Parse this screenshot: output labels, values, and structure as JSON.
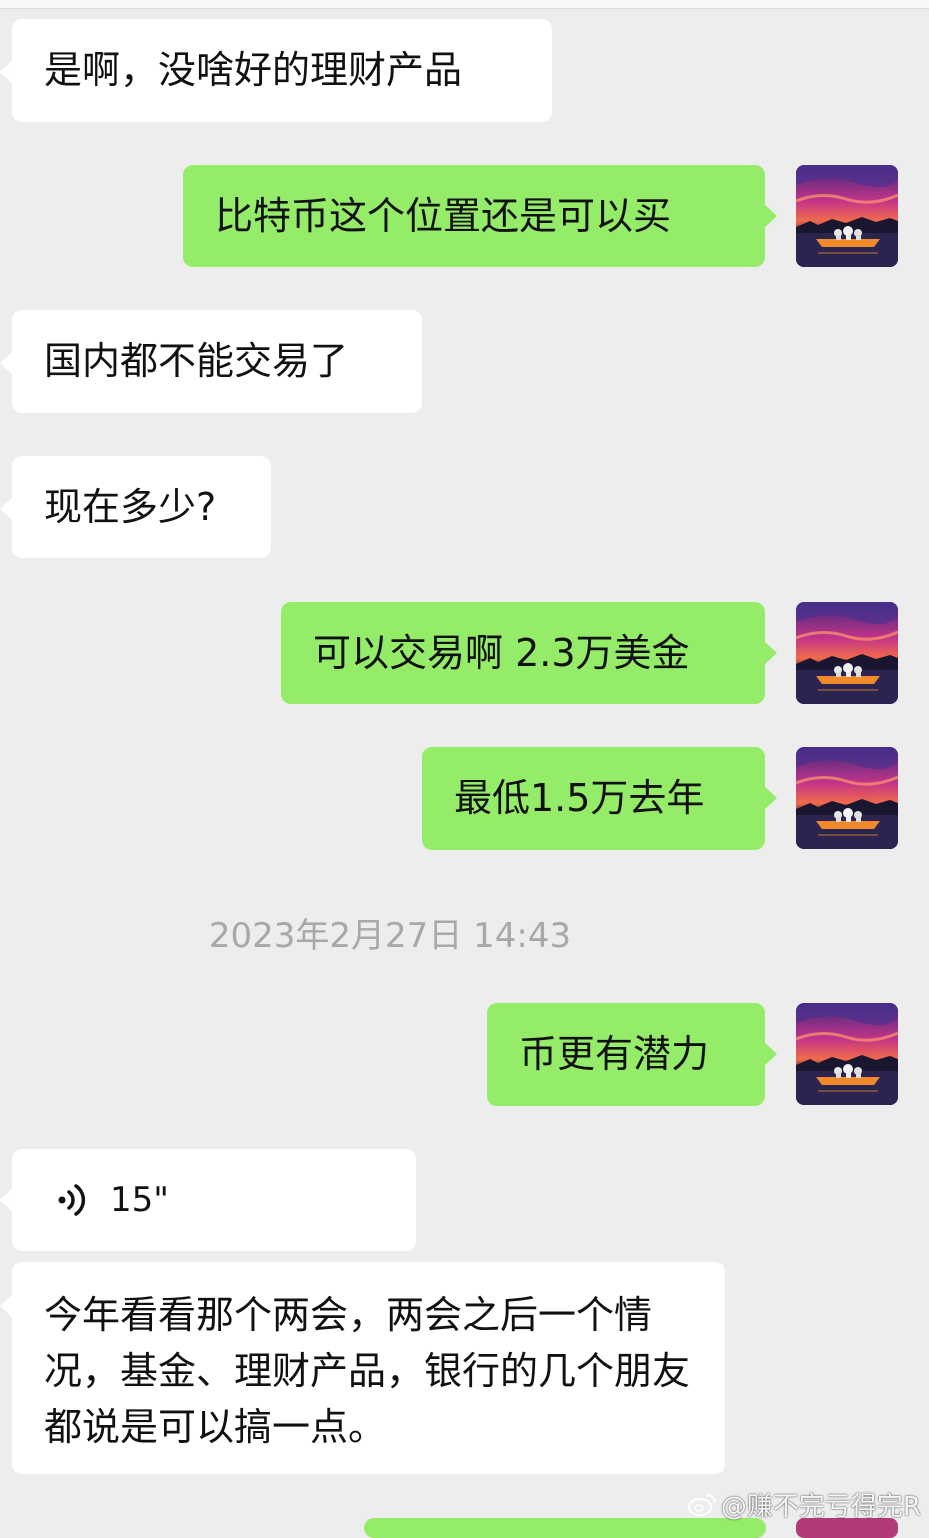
{
  "messages": [
    {
      "side": "left",
      "text": "是啊，没啥好的理财产品"
    },
    {
      "side": "right",
      "text": "比特币这个位置还是可以买"
    },
    {
      "side": "left",
      "text": "国内都不能交易了"
    },
    {
      "side": "left",
      "text": "现在多少?"
    },
    {
      "side": "right",
      "text": "可以交易啊 2.3万美金"
    },
    {
      "side": "right",
      "text": "最低1.5万去年"
    },
    {
      "side": "right",
      "text": "币更有潜力"
    },
    {
      "side": "left",
      "text": "今年看看那个两会，两会之后一个情况，基金、理财产品，银行的几个朋友都说是可以搞一点。"
    }
  ],
  "timestamp": "2023年2月27日 14:43",
  "voice_message": {
    "duration": "15\"",
    "icon": "voice-wave-icon"
  },
  "watermark": "@赚不完亏得完R",
  "avatar_icon": "sunset-boat-avatar",
  "colors": {
    "background": "#ededed",
    "sent_bubble": "#95ec69",
    "received_bubble": "#ffffff",
    "timestamp": "#a8a8a8"
  }
}
